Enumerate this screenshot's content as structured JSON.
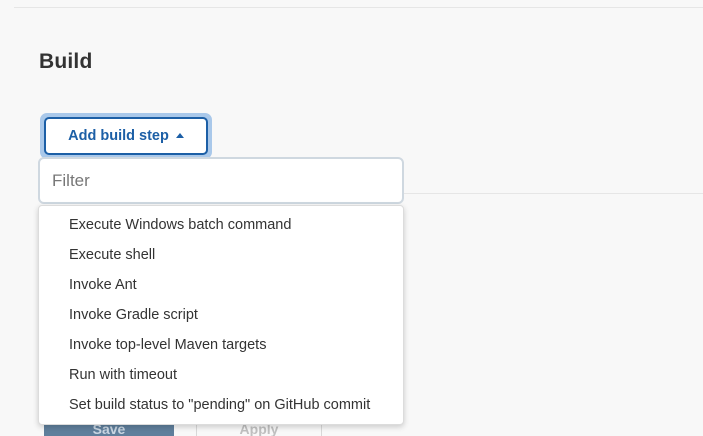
{
  "section": {
    "title": "Build"
  },
  "add_build_step": {
    "label": "Add build step",
    "caret_icon": "caret-up-icon"
  },
  "filter": {
    "placeholder": "Filter",
    "value": ""
  },
  "menu": {
    "items": [
      {
        "label": "Execute Windows batch command"
      },
      {
        "label": "Execute shell"
      },
      {
        "label": "Invoke Ant"
      },
      {
        "label": "Invoke Gradle script"
      },
      {
        "label": "Invoke top-level Maven targets"
      },
      {
        "label": "Run with timeout"
      },
      {
        "label": "Set build status to \"pending\" on GitHub commit"
      }
    ]
  },
  "footer_buttons": {
    "save_label": "Save",
    "apply_label": "Apply"
  },
  "colors": {
    "accent": "#1c5fa6",
    "focus_ring": "#a9c8ea",
    "background": "#f8f8f8"
  }
}
